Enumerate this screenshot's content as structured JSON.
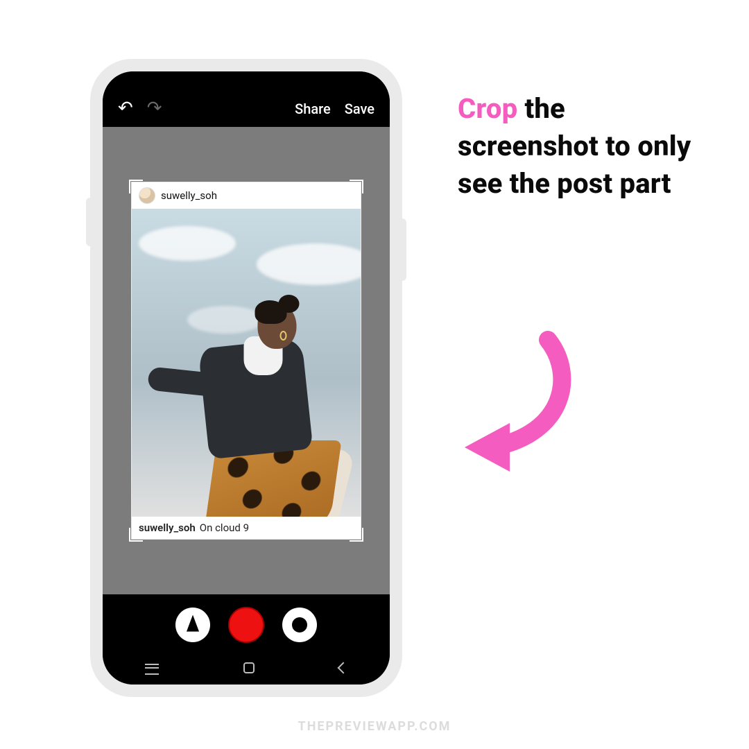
{
  "editor": {
    "share_label": "Share",
    "save_label": "Save"
  },
  "post": {
    "username": "suwelly_soh",
    "caption_username": "suwelly_soh",
    "caption_text": "On cloud 9"
  },
  "instruction": {
    "accent_word": "Crop",
    "rest": " the screenshot to only see the post part"
  },
  "colors": {
    "accent_pink": "#f45cc0",
    "record_red": "#ee1111"
  },
  "watermark": "THEPREVIEWAPP.COM"
}
